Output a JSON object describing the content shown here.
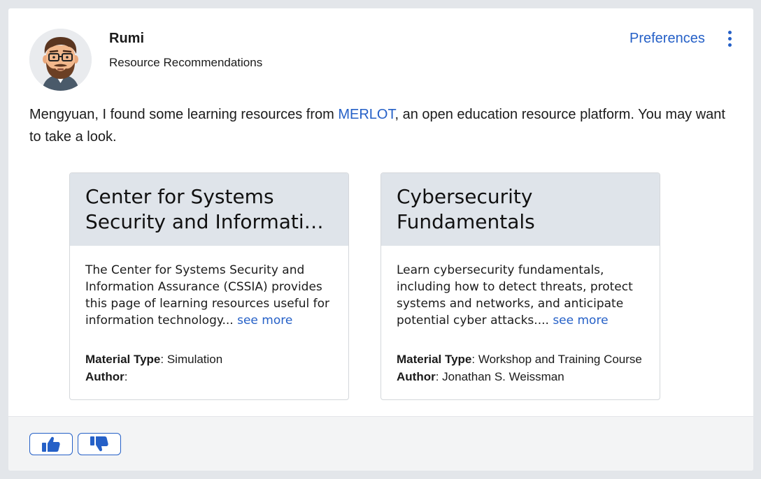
{
  "header": {
    "bot_name": "Rumi",
    "subtitle": "Resource Recommendations",
    "preferences_label": "Preferences",
    "avatar_icon": "bearded-man-with-glasses-avatar",
    "menu_icon": "vertical-ellipsis-icon"
  },
  "message": {
    "before_link": "Mengyuan, I found some learning resources from ",
    "link_text": "MERLOT",
    "after_link": ", an open education resource platform. You may want to take a look."
  },
  "cards": [
    {
      "title": "Center for Systems Security and Information Assurance",
      "description": "The Center for Systems Security and Information Assurance (CSSIA) provides this page of learning resources useful for information technology...",
      "see_more": "see more",
      "material_type_label": "Material Type",
      "material_type": "Simulation",
      "author_label": "Author",
      "author": ""
    },
    {
      "title": "Cybersecurity Fundamentals",
      "description": "Learn cybersecurity fundamentals, including how to detect threats, protect systems and networks, and anticipate potential cyber attacks....",
      "see_more": "see more",
      "material_type_label": "Material Type",
      "material_type": "Workshop and Training Course",
      "author_label": "Author",
      "author": "Jonathan S. Weissman"
    }
  ],
  "feedback": {
    "thumbs_up_icon": "thumbs-up-icon",
    "thumbs_down_icon": "thumbs-down-icon"
  },
  "colors": {
    "accent": "#2560c7",
    "card_header_bg": "#dfe4ea",
    "page_bg": "#e3e6ea"
  }
}
